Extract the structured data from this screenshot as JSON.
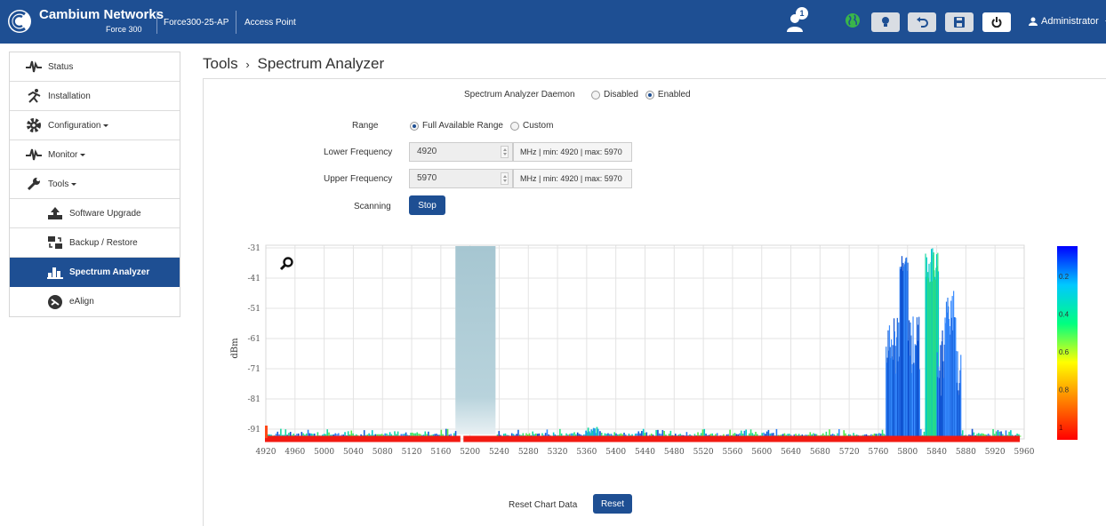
{
  "header": {
    "brand": "Cambium Networks",
    "model": "Force 300",
    "device_name": "Force300-25-AP",
    "mode": "Access Point",
    "notification_count": "1",
    "user": "Administrator",
    "colors": {
      "bar": "#1e4f93",
      "accent": "#1e4f93",
      "globe": "#39b54a"
    },
    "toolbar_icons": [
      "bulb-icon",
      "undo-icon",
      "save-icon",
      "power-icon"
    ]
  },
  "sidebar": {
    "items": [
      {
        "label": "Status",
        "icon": "pulse-icon",
        "dropdown": false
      },
      {
        "label": "Installation",
        "icon": "runner-icon",
        "dropdown": false
      },
      {
        "label": "Configuration",
        "icon": "gear-icon",
        "dropdown": true
      },
      {
        "label": "Monitor",
        "icon": "pulse-icon",
        "dropdown": true
      },
      {
        "label": "Tools",
        "icon": "wrench-icon",
        "dropdown": true
      },
      {
        "label": "Software Upgrade",
        "icon": "upgrade-icon",
        "dropdown": false
      },
      {
        "label": "Backup / Restore",
        "icon": "backup-icon",
        "dropdown": false
      },
      {
        "label": "Spectrum Analyzer",
        "icon": "bars-icon",
        "dropdown": false,
        "active": true
      },
      {
        "label": "eAlign",
        "icon": "align-icon",
        "dropdown": false
      }
    ]
  },
  "page": {
    "section": "Tools",
    "title": "Spectrum Analyzer"
  },
  "form": {
    "daemon_label": "Spectrum Analyzer Daemon",
    "daemon_options": [
      "Disabled",
      "Enabled"
    ],
    "daemon_selected": "Enabled",
    "range_label": "Range",
    "range_options": [
      "Full Available Range",
      "Custom"
    ],
    "range_selected": "Full Available Range",
    "lower_label": "Lower Frequency",
    "lower_value": "4920",
    "lower_hint": "MHz | min: 4920 | max: 5970",
    "upper_label": "Upper Frequency",
    "upper_value": "5970",
    "upper_hint": "MHz | min: 4920 | max: 5970",
    "scanning_label": "Scanning",
    "stop_label": "Stop",
    "reset_label": "Reset Chart Data",
    "reset_button": "Reset"
  },
  "chart_data": {
    "type": "heatmap",
    "ylabel": "dBm",
    "y_ticks": [
      -31,
      -41,
      -51,
      -61,
      -71,
      -81,
      -91
    ],
    "x_ticks": [
      4920,
      4960,
      5000,
      5040,
      5080,
      5120,
      5160,
      5200,
      5240,
      5280,
      5320,
      5360,
      5400,
      5440,
      5480,
      5520,
      5560,
      5600,
      5640,
      5680,
      5720,
      5760,
      5800,
      5840,
      5880,
      5920,
      5960
    ],
    "xlim": [
      4920,
      5960
    ],
    "ylim": [
      -95,
      -30
    ],
    "grid": true,
    "zoom_icon": "zoom-icon",
    "excluded_band": [
      5180,
      5235
    ],
    "floor_dbm": -93.5,
    "density_scale": {
      "ticks": [
        "0.2",
        "0.4",
        "0.6",
        "0.8",
        "1"
      ],
      "colors": [
        "#0000ff",
        "#00c8ff",
        "#00ff80",
        "#ffff00",
        "#ff8000",
        "#ff0000"
      ]
    },
    "peaks": [
      {
        "x": 5795,
        "peak_dbm": -31,
        "note": "blue cluster 5770-5815"
      },
      {
        "x": 5832,
        "peak_dbm": -31,
        "note": "green cluster 5825-5840"
      },
      {
        "x": 5860,
        "peak_dbm": -45,
        "note": "blue cluster 5840-5870"
      },
      {
        "x": 5365,
        "peak_dbm": -91,
        "note": "small cluster"
      }
    ]
  }
}
